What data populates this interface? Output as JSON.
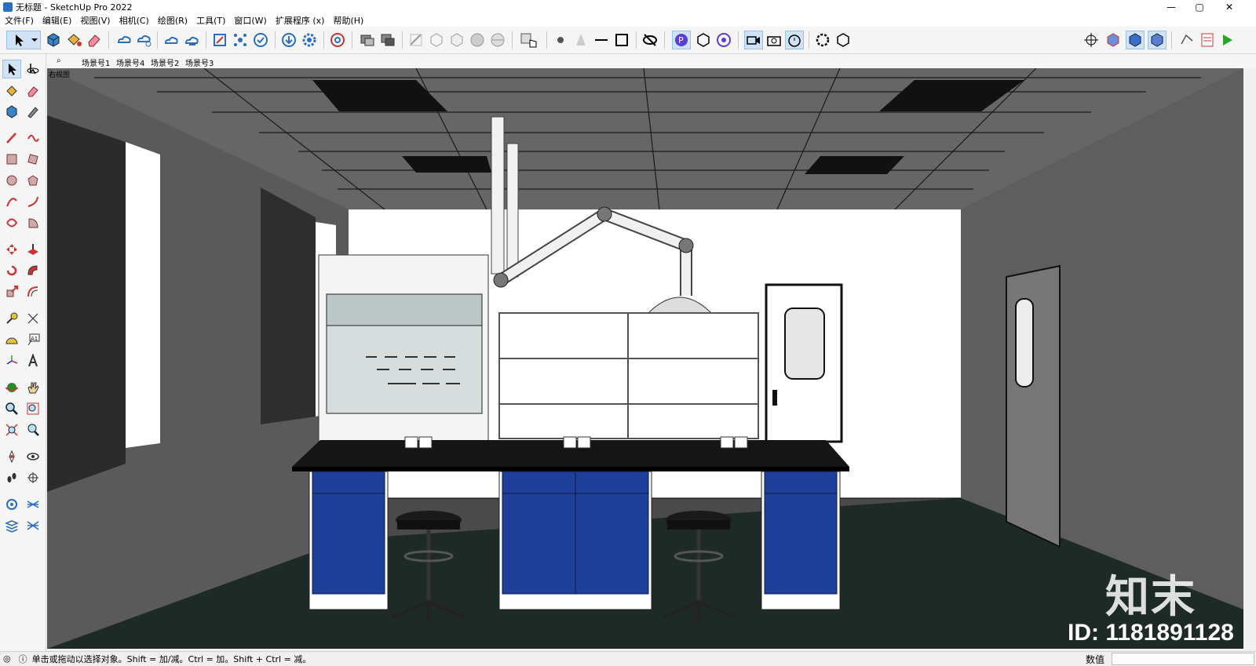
{
  "window": {
    "title": "无标题 - SketchUp Pro 2022",
    "controls": {
      "minimize": "—",
      "restore": "▢",
      "close": "✕"
    }
  },
  "menu": [
    "文件(F)",
    "编辑(E)",
    "视图(V)",
    "相机(C)",
    "绘图(R)",
    "工具(T)",
    "窗口(W)",
    "扩展程序 (x)",
    "帮助(H)"
  ],
  "scenes": {
    "search_icon": "search-icon",
    "tabs": [
      "场景号1",
      "场景号4",
      "场景号2",
      "场景号3"
    ],
    "active_index": 1
  },
  "viewport": {
    "view_label": "右视图",
    "watermark_logo": "知末",
    "watermark_id": "ID: 1181891128"
  },
  "status": {
    "message": "单击或拖动以选择对象。Shift = 加/减。Ctrl = 加。Shift + Ctrl = 减。",
    "measurements_label": "数值",
    "measurements_value": ""
  },
  "colors": {
    "cabinet_blue": "#1e3f9a",
    "countertop": "#151515",
    "floor": "#1e2a26",
    "walls": "#5a5a5a",
    "back_wall": "#ffffff"
  }
}
